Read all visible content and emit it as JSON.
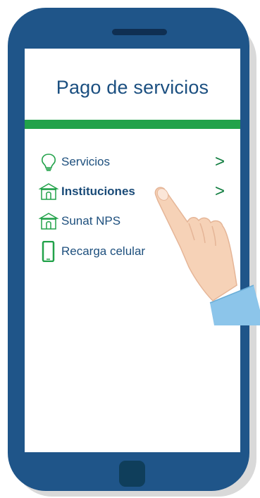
{
  "screen": {
    "title": "Pago de servicios"
  },
  "menu": {
    "items": [
      {
        "label": "Servicios",
        "bold": false,
        "has_arrow": true,
        "icon": "lightbulb-icon",
        "arrow": ">"
      },
      {
        "label": "Instituciones",
        "bold": true,
        "has_arrow": true,
        "icon": "bank-building-icon",
        "arrow": ">"
      },
      {
        "label": "Sunat NPS",
        "bold": false,
        "has_arrow": false,
        "icon": "bank-building-icon"
      },
      {
        "label": "Recarga celular",
        "bold": false,
        "has_arrow": false,
        "icon": "mobile-phone-icon"
      }
    ]
  },
  "colors": {
    "phone_body": "#1f5589",
    "phone_dark": "#0f2f52",
    "title": "#1b4f80",
    "accent_bar": "#22a24a",
    "icon_green": "#22a24a",
    "arrow_green": "#0f7c3e",
    "hand_skin": "#f6d2b7",
    "sleeve": "#8cc5ea"
  }
}
